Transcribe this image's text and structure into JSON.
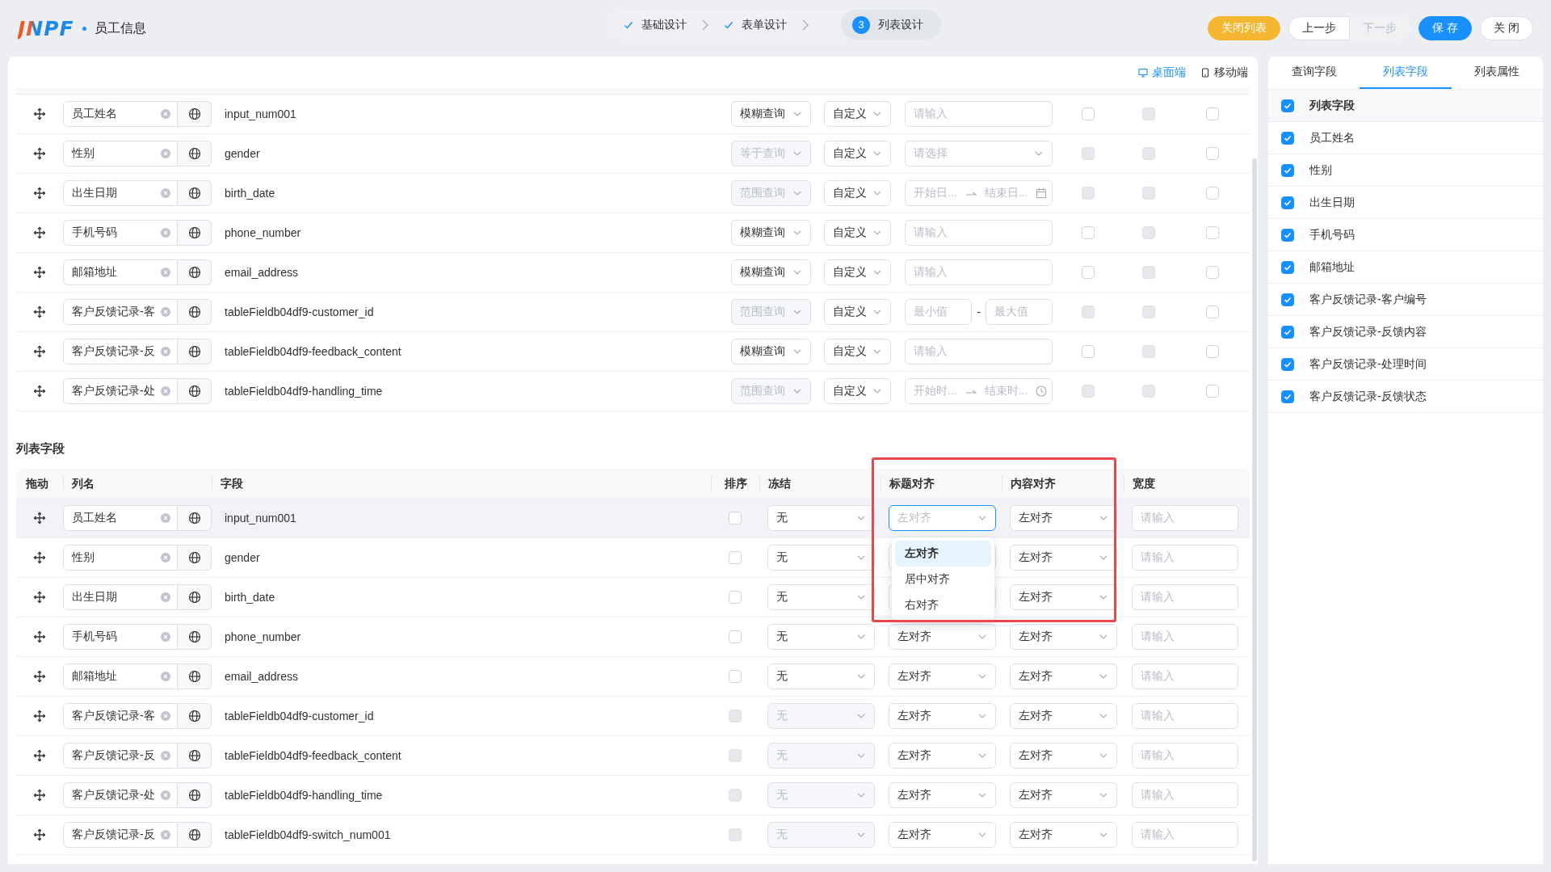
{
  "header": {
    "logo": "JNPF",
    "title": "员工信息",
    "steps": [
      {
        "label": "基础设计",
        "kind": "done"
      },
      {
        "label": "表单设计",
        "kind": "done"
      },
      {
        "number": "3",
        "label": "列表设计",
        "kind": "active"
      }
    ],
    "buttons": [
      {
        "label": "关闭列表",
        "kind": "warning",
        "disabled": false
      },
      {
        "label": "上一步",
        "kind": "default",
        "disabled": false
      },
      {
        "label": "下一步",
        "kind": "default",
        "disabled": true
      },
      {
        "label": "保 存",
        "kind": "primary",
        "disabled": false
      },
      {
        "label": "关 闭",
        "kind": "default",
        "disabled": false
      }
    ]
  },
  "device_toggle": [
    {
      "label": "桌面端",
      "kind": "desktop",
      "selected": true
    },
    {
      "label": "移动端",
      "kind": "mobile",
      "selected": false
    }
  ],
  "query_fields": {
    "rows": [
      {
        "name": "员工姓名",
        "field": "input_num001",
        "match": {
          "label": "模糊查询",
          "disabled": false
        },
        "control": "自定义",
        "value": {
          "kind": "text",
          "placeholder": "请输入"
        },
        "checks": [
          {
            "disabled": false
          },
          {
            "disabled": true
          },
          {
            "disabled": false
          }
        ]
      },
      {
        "name": "性别",
        "field": "gender",
        "match": {
          "label": "等于查询",
          "disabled": true
        },
        "control": "自定义",
        "value": {
          "kind": "select",
          "placeholder": "请选择"
        },
        "checks": [
          {
            "disabled": true
          },
          {
            "disabled": true
          },
          {
            "disabled": false
          }
        ]
      },
      {
        "name": "出生日期",
        "field": "birth_date",
        "match": {
          "label": "范围查询",
          "disabled": true
        },
        "control": "自定义",
        "value": {
          "kind": "date_range",
          "start": "开始日...",
          "end": "结束日..."
        },
        "checks": [
          {
            "disabled": true
          },
          {
            "disabled": true
          },
          {
            "disabled": false
          }
        ]
      },
      {
        "name": "手机号码",
        "field": "phone_number",
        "match": {
          "label": "模糊查询",
          "disabled": false
        },
        "control": "自定义",
        "value": {
          "kind": "text",
          "placeholder": "请输入"
        },
        "checks": [
          {
            "disabled": false
          },
          {
            "disabled": true
          },
          {
            "disabled": false
          }
        ]
      },
      {
        "name": "邮箱地址",
        "field": "email_address",
        "match": {
          "label": "模糊查询",
          "disabled": false
        },
        "control": "自定义",
        "value": {
          "kind": "text",
          "placeholder": "请输入"
        },
        "checks": [
          {
            "disabled": false
          },
          {
            "disabled": true
          },
          {
            "disabled": false
          }
        ]
      },
      {
        "name": "客户反馈记录-客",
        "field": "tableFieldb04df9-customer_id",
        "match": {
          "label": "范围查询",
          "disabled": true
        },
        "control": "自定义",
        "value": {
          "kind": "number_range",
          "min": "最小值",
          "separator": "-",
          "max": "最大值"
        },
        "checks": [
          {
            "disabled": true
          },
          {
            "disabled": true
          },
          {
            "disabled": false
          }
        ]
      },
      {
        "name": "客户反馈记录-反",
        "field": "tableFieldb04df9-feedback_content",
        "match": {
          "label": "模糊查询",
          "disabled": false
        },
        "control": "自定义",
        "value": {
          "kind": "text",
          "placeholder": "请输入"
        },
        "checks": [
          {
            "disabled": false
          },
          {
            "disabled": true
          },
          {
            "disabled": false
          }
        ]
      },
      {
        "name": "客户反馈记录-处",
        "field": "tableFieldb04df9-handling_time",
        "match": {
          "label": "范围查询",
          "disabled": true
        },
        "control": "自定义",
        "value": {
          "kind": "time_range",
          "start": "开始时...",
          "end": "结束时..."
        },
        "checks": [
          {
            "disabled": true
          },
          {
            "disabled": true
          },
          {
            "disabled": false
          }
        ]
      }
    ]
  },
  "list_fields": {
    "title": "列表字段",
    "columns": [
      "拖动",
      "列名",
      "字段",
      "排序",
      "冻结",
      "标题对齐",
      "内容对齐",
      "宽度"
    ],
    "rows": [
      {
        "name": "员工姓名",
        "field": "input_num001",
        "hovered": true,
        "sort": {
          "disabled": false
        },
        "freeze": {
          "label": "无",
          "disabled": false
        },
        "title_align": {
          "label": "左对齐",
          "focused": true,
          "menu": [
            {
              "label": "左对齐",
              "selected": true
            },
            {
              "label": "居中对齐",
              "selected": false
            },
            {
              "label": "右对齐",
              "selected": false
            }
          ]
        },
        "content_align": "左对齐",
        "width": {
          "placeholder": "请输入"
        }
      },
      {
        "name": "性别",
        "field": "gender",
        "hovered": false,
        "sort": {
          "disabled": false
        },
        "freeze": {
          "label": "无",
          "disabled": false
        },
        "content_align": "左对齐",
        "width": {
          "placeholder": "请输入"
        }
      },
      {
        "name": "出生日期",
        "field": "birth_date",
        "hovered": false,
        "sort": {
          "disabled": false
        },
        "freeze": {
          "label": "无",
          "disabled": false
        },
        "content_align": "左对齐",
        "width": {
          "placeholder": "请输入"
        }
      },
      {
        "name": "手机号码",
        "field": "phone_number",
        "hovered": false,
        "sort": {
          "disabled": false
        },
        "freeze": {
          "label": "无",
          "disabled": false
        },
        "title_align": {
          "label": "左对齐",
          "focused": false
        },
        "content_align": "左对齐",
        "width": {
          "placeholder": "请输入"
        }
      },
      {
        "name": "邮箱地址",
        "field": "email_address",
        "hovered": false,
        "sort": {
          "disabled": false
        },
        "freeze": {
          "label": "无",
          "disabled": false
        },
        "title_align": {
          "label": "左对齐",
          "focused": false
        },
        "content_align": "左对齐",
        "width": {
          "placeholder": "请输入"
        }
      },
      {
        "name": "客户反馈记录-客",
        "field": "tableFieldb04df9-customer_id",
        "hovered": false,
        "sort": {
          "disabled": true
        },
        "freeze": {
          "label": "无",
          "disabled": true
        },
        "title_align": {
          "label": "左对齐",
          "focused": false
        },
        "content_align": "左对齐",
        "width": {
          "placeholder": "请输入"
        }
      },
      {
        "name": "客户反馈记录-反",
        "field": "tableFieldb04df9-feedback_content",
        "hovered": false,
        "sort": {
          "disabled": true
        },
        "freeze": {
          "label": "无",
          "disabled": true
        },
        "title_align": {
          "label": "左对齐",
          "focused": false
        },
        "content_align": "左对齐",
        "width": {
          "placeholder": "请输入"
        }
      },
      {
        "name": "客户反馈记录-处",
        "field": "tableFieldb04df9-handling_time",
        "hovered": false,
        "sort": {
          "disabled": true
        },
        "freeze": {
          "label": "无",
          "disabled": true
        },
        "title_align": {
          "label": "左对齐",
          "focused": false
        },
        "content_align": "左对齐",
        "width": {
          "placeholder": "请输入"
        }
      },
      {
        "name": "客户反馈记录-反",
        "field": "tableFieldb04df9-switch_num001",
        "hovered": false,
        "sort": {
          "disabled": true
        },
        "freeze": {
          "label": "无",
          "disabled": true
        },
        "title_align": {
          "label": "左对齐",
          "focused": false
        },
        "content_align": "左对齐",
        "width": {
          "placeholder": "请输入"
        }
      }
    ]
  },
  "side_panel": {
    "tabs": [
      {
        "label": "查询字段",
        "selected": false
      },
      {
        "label": "列表字段",
        "selected": true
      },
      {
        "label": "列表属性",
        "selected": false
      }
    ],
    "items": [
      {
        "label": "列表字段",
        "kind": "header",
        "checked": true
      },
      {
        "label": "员工姓名",
        "kind": "item",
        "checked": true
      },
      {
        "label": "性别",
        "kind": "item",
        "checked": true
      },
      {
        "label": "出生日期",
        "kind": "item",
        "checked": true
      },
      {
        "label": "手机号码",
        "kind": "item",
        "checked": true
      },
      {
        "label": "邮箱地址",
        "kind": "item",
        "checked": true
      },
      {
        "label": "客户反馈记录-客户编号",
        "kind": "item",
        "checked": true
      },
      {
        "label": "客户反馈记录-反馈内容",
        "kind": "item",
        "checked": true
      },
      {
        "label": "客户反馈记录-处理时间",
        "kind": "item",
        "checked": true
      },
      {
        "label": "客户反馈记录-反馈状态",
        "kind": "item",
        "checked": true
      }
    ]
  }
}
